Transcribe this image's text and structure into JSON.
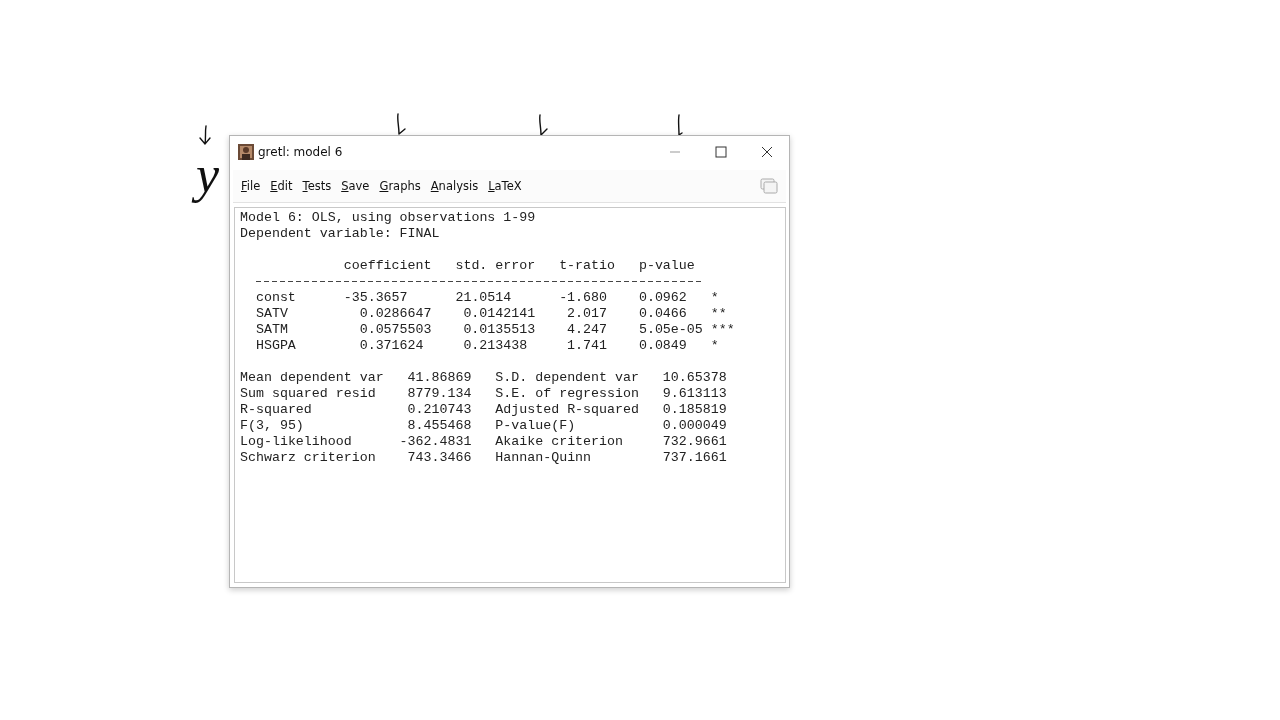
{
  "annotation": {
    "letter": "y"
  },
  "window": {
    "title": "gretl: model 6"
  },
  "menu": [
    "File",
    "Edit",
    "Tests",
    "Save",
    "Graphs",
    "Analysis",
    "LaTeX"
  ],
  "output": {
    "header_lines": [
      "Model 6: OLS, using observations 1-99",
      "Dependent variable: FINAL"
    ],
    "coef_table": {
      "columns": [
        "coefficient",
        "std. error",
        "t-ratio",
        "p-value"
      ],
      "rows": [
        {
          "name": "const",
          "values": [
            "-35.3657",
            "21.0514",
            "-1.680",
            "0.0962"
          ],
          "significance": "*"
        },
        {
          "name": "SATV",
          "values": [
            "0.0286647",
            "0.0142141",
            "2.017",
            "0.0466"
          ],
          "significance": "**"
        },
        {
          "name": "SATM",
          "values": [
            "0.0575503",
            "0.0135513",
            "4.247",
            "5.05e-05"
          ],
          "significance": "***"
        },
        {
          "name": "HSGPA",
          "values": [
            "0.371624",
            "0.213438",
            "1.741",
            "0.0849"
          ],
          "significance": "*"
        }
      ]
    },
    "stats": [
      {
        "label_1": "Mean dependent var",
        "value_1": "41.86869",
        "label_2": "S.D. dependent var",
        "value_2": "10.65378"
      },
      {
        "label_1": "Sum squared resid",
        "value_1": "8779.134",
        "label_2": "S.E. of regression",
        "value_2": "9.613113"
      },
      {
        "label_1": "R-squared",
        "value_1": "0.210743",
        "label_2": "Adjusted R-squared",
        "value_2": "0.185819"
      },
      {
        "label_1": "F(3, 95)",
        "value_1": "8.455468",
        "label_2": "P-value(F)",
        "value_2": "0.000049"
      },
      {
        "label_1": "Log-likelihood",
        "value_1": "-362.4831",
        "label_2": "Akaike criterion",
        "value_2": "732.9661"
      },
      {
        "label_1": "Schwarz criterion",
        "value_1": "743.3466",
        "label_2": "Hannan-Quinn",
        "value_2": "737.1661"
      }
    ]
  }
}
